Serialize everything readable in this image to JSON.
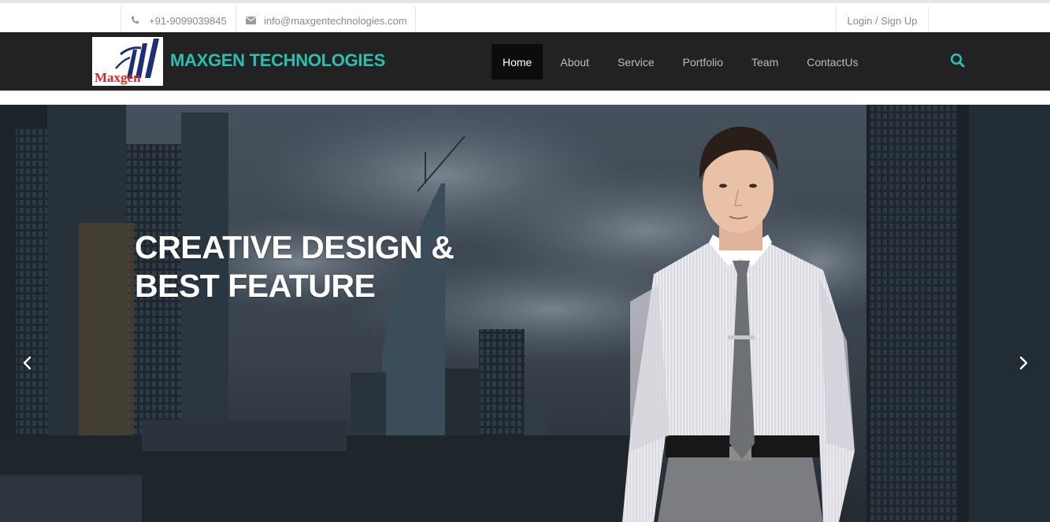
{
  "topbar": {
    "phone": "+91-9099039845",
    "phone_icon": "phone-icon",
    "email": "info@maxgentechnologies.com",
    "email_icon": "envelope-icon",
    "login": "Login / Sign Up"
  },
  "navbar": {
    "logo_text": "Maxgen",
    "brand": "MAXGEN TECHNOLOGIES",
    "items": [
      {
        "label": "Home",
        "active": true
      },
      {
        "label": "About"
      },
      {
        "label": "Service"
      },
      {
        "label": "Portfolio"
      },
      {
        "label": "Team"
      },
      {
        "label": "ContactUs"
      }
    ],
    "search_icon": "search-icon"
  },
  "hero": {
    "title_line1": "CREATIVE DESIGN &",
    "title_line2": "BEST FEATURE",
    "prev_icon": "chevron-left-icon",
    "next_icon": "chevron-right-icon"
  },
  "colors": {
    "brand_teal": "#2bbfb1",
    "nav_bg": "#222222",
    "nav_active_bg": "#0c0c0c",
    "logo_red": "#d9262b",
    "logo_navy": "#1d2f78"
  }
}
